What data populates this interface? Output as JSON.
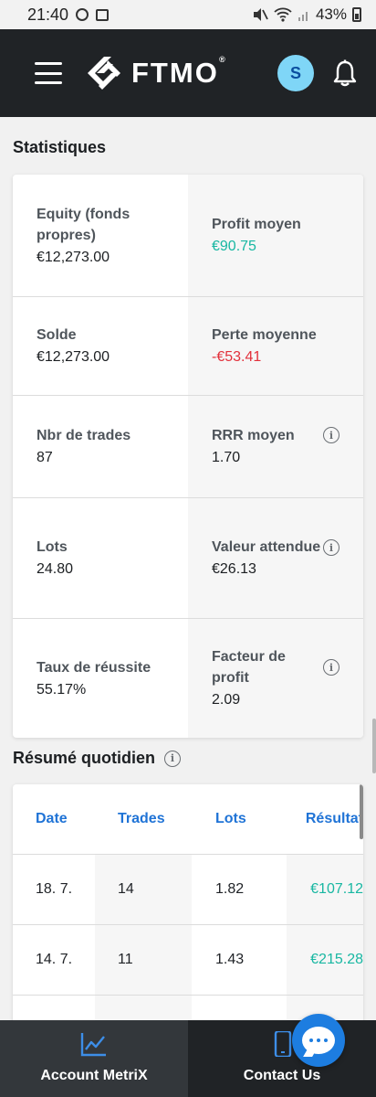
{
  "status_bar": {
    "time": "21:40",
    "battery": "43%"
  },
  "header": {
    "brand": "FTMO",
    "trademark": "®",
    "avatar_initial": "S"
  },
  "statistics": {
    "title": "Statistiques",
    "rows": [
      {
        "left": {
          "label": "Equity (fonds propres)",
          "value": "€12,273.00"
        },
        "right": {
          "label": "Profit moyen",
          "value": "€90.75"
        }
      },
      {
        "left": {
          "label": "Solde",
          "value": "€12,273.00"
        },
        "right": {
          "label": "Perte moyenne",
          "value": "-€53.41"
        }
      },
      {
        "left": {
          "label": "Nbr de trades",
          "value": "87"
        },
        "right": {
          "label": "RRR moyen",
          "value": "1.70"
        }
      },
      {
        "left": {
          "label": "Lots",
          "value": "24.80"
        },
        "right": {
          "label": "Valeur attendue",
          "value": "€26.13"
        }
      },
      {
        "left": {
          "label": "Taux de réussite",
          "value": "55.17%"
        },
        "right": {
          "label": "Facteur de profit",
          "value": "2.09"
        }
      }
    ]
  },
  "daily_summary": {
    "title": "Résumé quotidien",
    "columns": [
      "Date",
      "Trades",
      "Lots",
      "Résultat"
    ],
    "rows": [
      [
        "18. 7.",
        "14",
        "1.82",
        "€107.12"
      ],
      [
        "14. 7.",
        "11",
        "1.43",
        "€215.28"
      ]
    ]
  },
  "bottom_nav": {
    "left_label": "Account MetriX",
    "right_label": "Contact Us"
  },
  "colors": {
    "positive": "#18b7a2",
    "negative": "#e2303b",
    "link": "#1f73d6",
    "header_bg": "#202326"
  }
}
